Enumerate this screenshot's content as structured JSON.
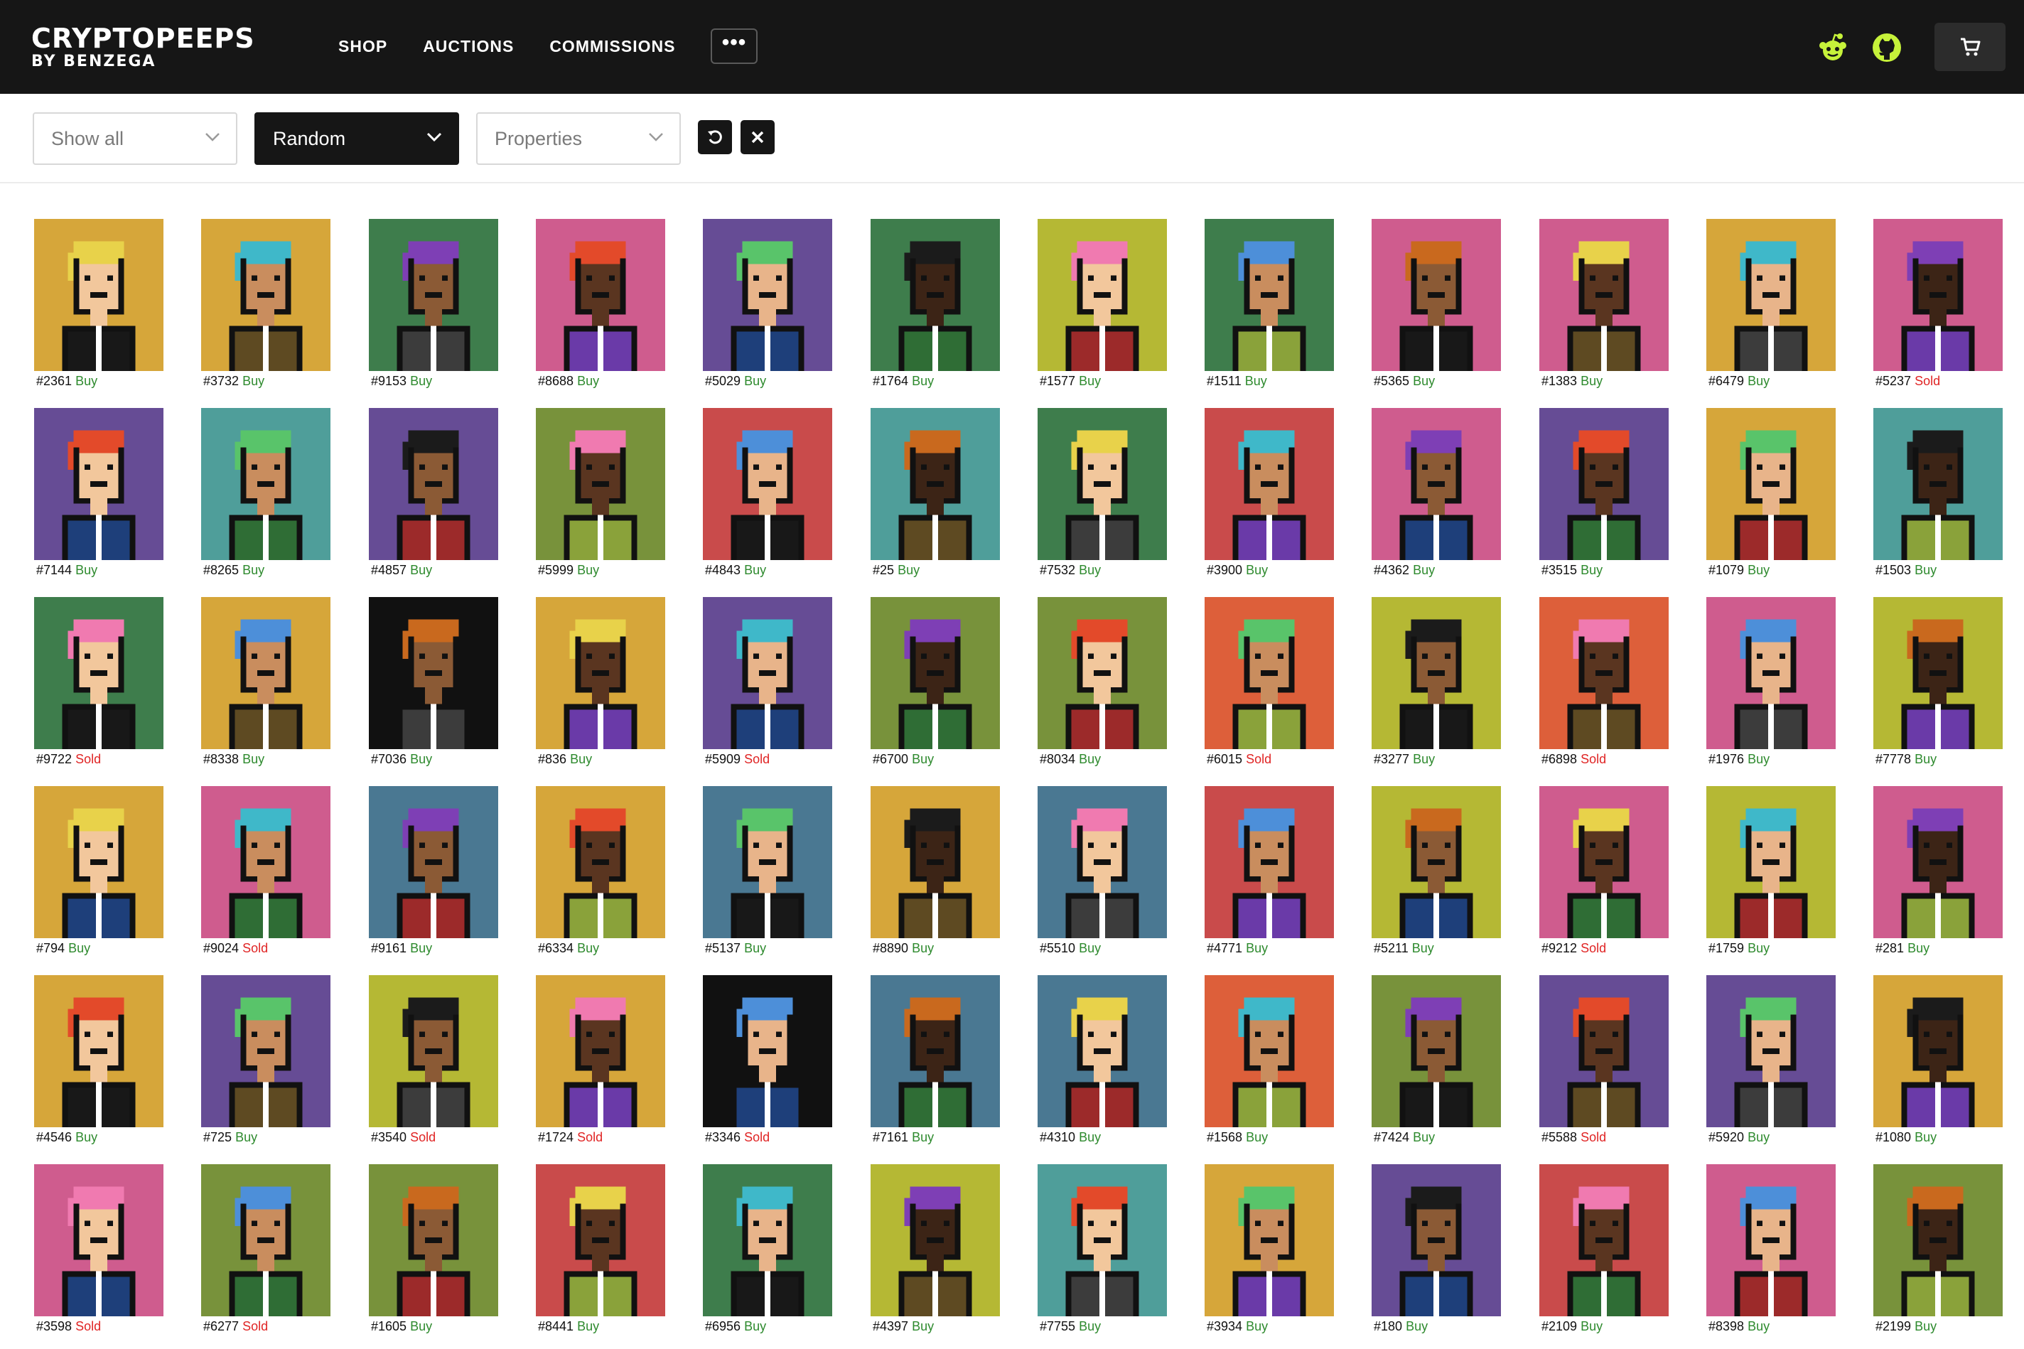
{
  "header": {
    "logo_line1": "CRYPTOPEEPS",
    "logo_line2": "BY BENZEGA",
    "nav": [
      "SHOP",
      "AUCTIONS",
      "COMMISSIONS"
    ],
    "more_label": "•••",
    "icons": [
      "reddit-icon",
      "github-icon",
      "cart-icon"
    ],
    "accent_color": "#c6f23a"
  },
  "filters": {
    "show": "Show all",
    "sort": "Random",
    "properties": "Properties",
    "buttons": [
      "refresh-icon",
      "close-icon"
    ]
  },
  "colors": {
    "buy": "#2e8a2e",
    "sold": "#e02424"
  },
  "peeps": [
    {
      "id": "#2361",
      "status": "Buy",
      "bg": "#d6a63a"
    },
    {
      "id": "#3732",
      "status": "Buy",
      "bg": "#d6a63a"
    },
    {
      "id": "#9153",
      "status": "Buy",
      "bg": "#3e7d4c"
    },
    {
      "id": "#8688",
      "status": "Buy",
      "bg": "#cf5c8e"
    },
    {
      "id": "#5029",
      "status": "Buy",
      "bg": "#664c95"
    },
    {
      "id": "#1764",
      "status": "Buy",
      "bg": "#3e7d4c"
    },
    {
      "id": "#1577",
      "status": "Buy",
      "bg": "#b5b834"
    },
    {
      "id": "#1511",
      "status": "Buy",
      "bg": "#3e7d4c"
    },
    {
      "id": "#5365",
      "status": "Buy",
      "bg": "#cf5c8e"
    },
    {
      "id": "#1383",
      "status": "Buy",
      "bg": "#cf5c8e"
    },
    {
      "id": "#6479",
      "status": "Buy",
      "bg": "#d6a63a"
    },
    {
      "id": "#5237",
      "status": "Sold",
      "bg": "#cf5c8e"
    },
    {
      "id": "#7144",
      "status": "Buy",
      "bg": "#664c95"
    },
    {
      "id": "#8265",
      "status": "Buy",
      "bg": "#4f9e9a"
    },
    {
      "id": "#4857",
      "status": "Buy",
      "bg": "#664c95"
    },
    {
      "id": "#5999",
      "status": "Buy",
      "bg": "#78923b"
    },
    {
      "id": "#4843",
      "status": "Buy",
      "bg": "#c94b4b"
    },
    {
      "id": "#25",
      "status": "Buy",
      "bg": "#4f9e9a"
    },
    {
      "id": "#7532",
      "status": "Buy",
      "bg": "#3e7d4c"
    },
    {
      "id": "#3900",
      "status": "Buy",
      "bg": "#c94b4b"
    },
    {
      "id": "#4362",
      "status": "Buy",
      "bg": "#cf5c8e"
    },
    {
      "id": "#3515",
      "status": "Buy",
      "bg": "#664c95"
    },
    {
      "id": "#1079",
      "status": "Buy",
      "bg": "#d6a63a"
    },
    {
      "id": "#1503",
      "status": "Buy",
      "bg": "#4f9e9a"
    },
    {
      "id": "#9722",
      "status": "Sold",
      "bg": "#3e7d4c"
    },
    {
      "id": "#8338",
      "status": "Buy",
      "bg": "#d6a63a"
    },
    {
      "id": "#7036",
      "status": "Buy",
      "bg": "#111111"
    },
    {
      "id": "#836",
      "status": "Buy",
      "bg": "#d6a63a"
    },
    {
      "id": "#5909",
      "status": "Sold",
      "bg": "#664c95"
    },
    {
      "id": "#6700",
      "status": "Buy",
      "bg": "#78923b"
    },
    {
      "id": "#8034",
      "status": "Buy",
      "bg": "#78923b"
    },
    {
      "id": "#6015",
      "status": "Sold",
      "bg": "#dd5f3a"
    },
    {
      "id": "#3277",
      "status": "Buy",
      "bg": "#b5b834"
    },
    {
      "id": "#6898",
      "status": "Sold",
      "bg": "#dd5f3a"
    },
    {
      "id": "#1976",
      "status": "Buy",
      "bg": "#cf5c8e"
    },
    {
      "id": "#7778",
      "status": "Buy",
      "bg": "#b5b834"
    },
    {
      "id": "#794",
      "status": "Buy",
      "bg": "#d6a63a"
    },
    {
      "id": "#9024",
      "status": "Sold",
      "bg": "#cf5c8e"
    },
    {
      "id": "#9161",
      "status": "Buy",
      "bg": "#4a7892"
    },
    {
      "id": "#6334",
      "status": "Buy",
      "bg": "#d6a63a"
    },
    {
      "id": "#5137",
      "status": "Buy",
      "bg": "#4a7892"
    },
    {
      "id": "#8890",
      "status": "Buy",
      "bg": "#d6a63a"
    },
    {
      "id": "#5510",
      "status": "Buy",
      "bg": "#4a7892"
    },
    {
      "id": "#4771",
      "status": "Buy",
      "bg": "#c94b4b"
    },
    {
      "id": "#5211",
      "status": "Buy",
      "bg": "#b5b834"
    },
    {
      "id": "#9212",
      "status": "Sold",
      "bg": "#cf5c8e"
    },
    {
      "id": "#1759",
      "status": "Buy",
      "bg": "#b5b834"
    },
    {
      "id": "#281",
      "status": "Buy",
      "bg": "#cf5c8e"
    },
    {
      "id": "#4546",
      "status": "Buy",
      "bg": "#d6a63a"
    },
    {
      "id": "#725",
      "status": "Buy",
      "bg": "#664c95"
    },
    {
      "id": "#3540",
      "status": "Sold",
      "bg": "#b5b834"
    },
    {
      "id": "#1724",
      "status": "Sold",
      "bg": "#d6a63a"
    },
    {
      "id": "#3346",
      "status": "Sold",
      "bg": "#111111"
    },
    {
      "id": "#7161",
      "status": "Buy",
      "bg": "#4a7892"
    },
    {
      "id": "#4310",
      "status": "Buy",
      "bg": "#4a7892"
    },
    {
      "id": "#1568",
      "status": "Buy",
      "bg": "#dd5f3a"
    },
    {
      "id": "#7424",
      "status": "Buy",
      "bg": "#78923b"
    },
    {
      "id": "#5588",
      "status": "Sold",
      "bg": "#664c95"
    },
    {
      "id": "#5920",
      "status": "Buy",
      "bg": "#664c95"
    },
    {
      "id": "#1080",
      "status": "Buy",
      "bg": "#d6a63a"
    },
    {
      "id": "#3598",
      "status": "Sold",
      "bg": "#cf5c8e"
    },
    {
      "id": "#6277",
      "status": "Sold",
      "bg": "#78923b"
    },
    {
      "id": "#1605",
      "status": "Buy",
      "bg": "#78923b"
    },
    {
      "id": "#8441",
      "status": "Buy",
      "bg": "#c94b4b"
    },
    {
      "id": "#6956",
      "status": "Buy",
      "bg": "#3e7d4c"
    },
    {
      "id": "#4397",
      "status": "Buy",
      "bg": "#b5b834"
    },
    {
      "id": "#7755",
      "status": "Buy",
      "bg": "#4f9e9a"
    },
    {
      "id": "#3934",
      "status": "Buy",
      "bg": "#d6a63a"
    },
    {
      "id": "#180",
      "status": "Buy",
      "bg": "#664c95"
    },
    {
      "id": "#2109",
      "status": "Buy",
      "bg": "#c94b4b"
    },
    {
      "id": "#8398",
      "status": "Buy",
      "bg": "#cf5c8e"
    },
    {
      "id": "#2199",
      "status": "Buy",
      "bg": "#78923b"
    }
  ]
}
